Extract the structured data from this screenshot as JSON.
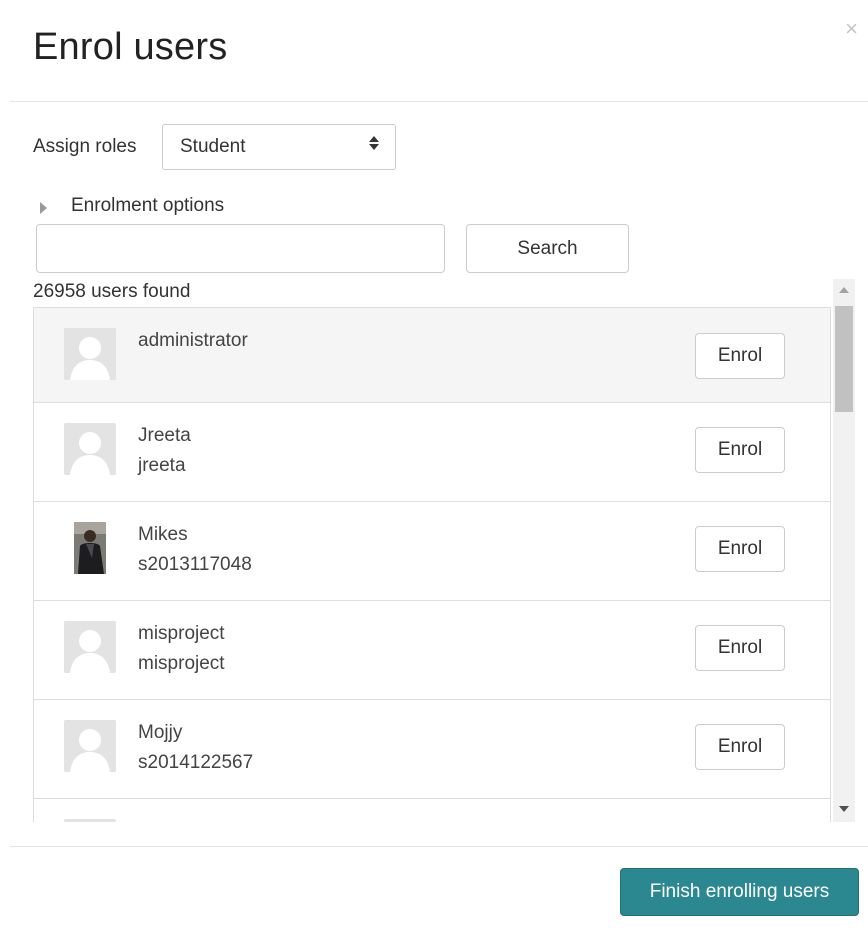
{
  "modal": {
    "title": "Enrol users",
    "close_glyph": "×"
  },
  "roles": {
    "label": "Assign roles",
    "selected": "Student"
  },
  "enrolment_options": {
    "label": "Enrolment options"
  },
  "search": {
    "value": "",
    "placeholder": "",
    "button_label": "Search"
  },
  "results": {
    "count_text": "26958 users found"
  },
  "users": [
    {
      "name": "administrator",
      "id": "",
      "avatar": "default-avatar",
      "enrol_label": "Enrol",
      "highlighted": true
    },
    {
      "name": "Jreeta",
      "id": "jreeta",
      "avatar": "default-avatar",
      "enrol_label": "Enrol"
    },
    {
      "name": "Mikes",
      "id": "s2013117048",
      "avatar": "photo-avatar",
      "enrol_label": "Enrol"
    },
    {
      "name": "misproject",
      "id": "misproject",
      "avatar": "default-avatar",
      "enrol_label": "Enrol"
    },
    {
      "name": "Mojjy",
      "id": "s2014122567",
      "avatar": "default-avatar",
      "enrol_label": "Enrol"
    },
    {
      "name": "",
      "id": "",
      "avatar": "default-avatar",
      "enrol_label": ""
    }
  ],
  "footer": {
    "finish_label": "Finish enrolling users"
  },
  "colors": {
    "primary_button": "#2b8790",
    "row_highlight": "#f5f5f5",
    "border": "#dddddd"
  }
}
